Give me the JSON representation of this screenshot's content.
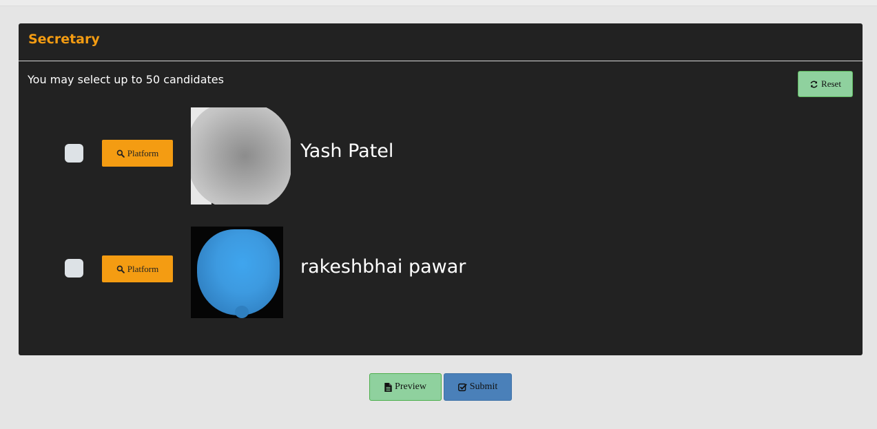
{
  "ballot": {
    "position_title": "Secretary",
    "instruction": "You may select up to 50 candidates",
    "reset_label": "Reset",
    "candidates": [
      {
        "name": "Yash Patel",
        "platform_label": "Platform",
        "selected": false,
        "photo_tone": "#b0b0b0"
      },
      {
        "name": "rakeshbhai pawar",
        "platform_label": "Platform",
        "selected": false,
        "photo_tone": "#3d9ae0"
      }
    ]
  },
  "actions": {
    "preview_label": "Preview",
    "submit_label": "Submit"
  },
  "colors": {
    "page_bg": "#e5e5e5",
    "panel_bg": "#222222",
    "accent": "#f49c12",
    "reset_green": "#8fd19e",
    "submit_blue": "#4a80b9"
  },
  "icons": {
    "reset": "refresh-icon",
    "platform": "search-icon",
    "preview": "file-icon",
    "submit": "check-square-icon"
  }
}
